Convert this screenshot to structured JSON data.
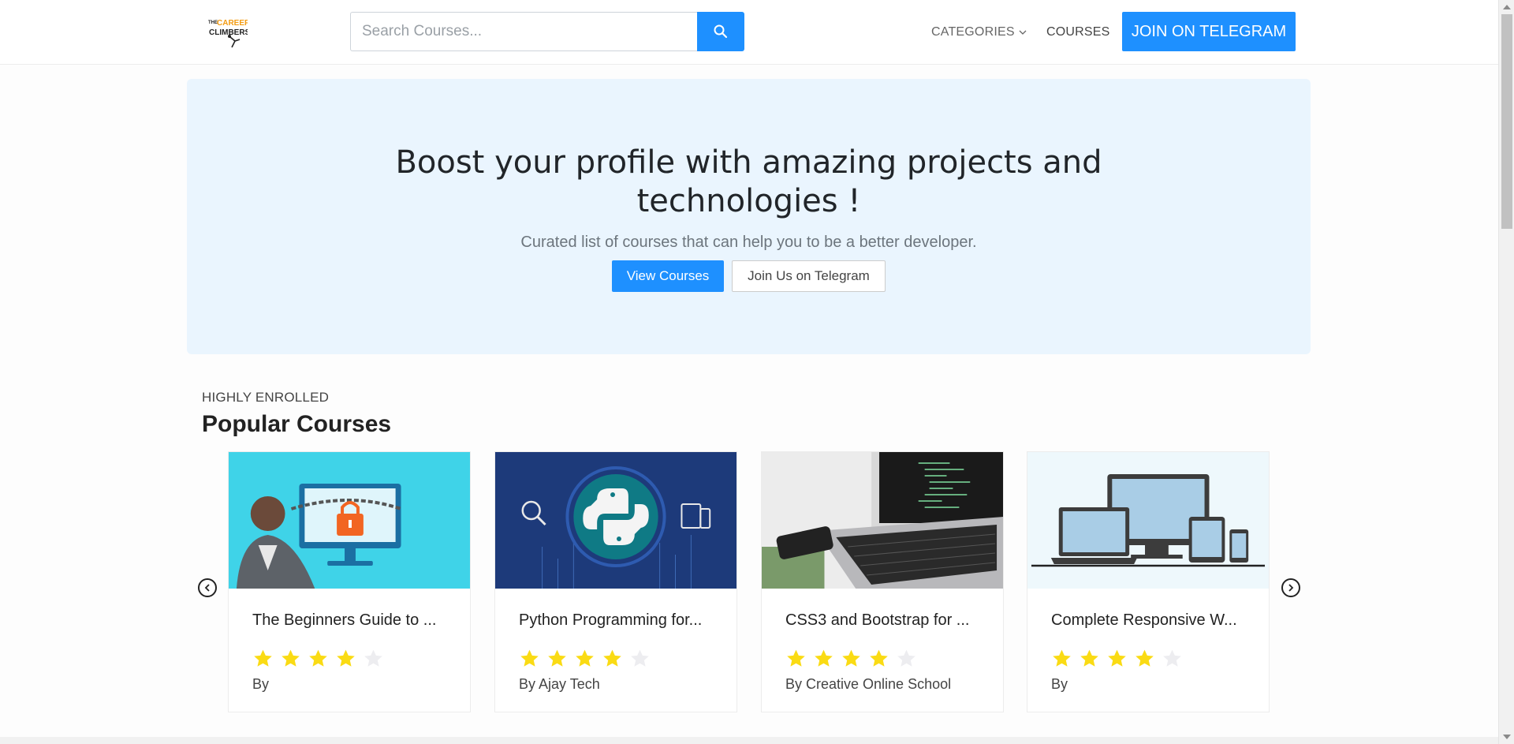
{
  "nav": {
    "logo_text": "THE CAREER CLIMBERS",
    "search_placeholder": "Search Courses...",
    "categories_label": "CATEGORIES",
    "courses_label": "COURSES",
    "telegram_button": "JOIN ON TELEGRAM",
    "accent_color": "#1e90ff"
  },
  "hero": {
    "title_line1": "Boost your profile with amazing projects and",
    "title_line2": "technologies !",
    "subtitle": "Curated list of courses that can help you to be a better developer.",
    "primary_button": "View Courses",
    "secondary_button": "Join Us on Telegram"
  },
  "section": {
    "eyebrow": "HIGHLY ENROLLED",
    "title": "Popular Courses"
  },
  "courses": [
    {
      "title": "The Beginners Guide to ...",
      "rating": 4,
      "max_rating": 5,
      "author": "By",
      "image_icon": "cyber-security-icon"
    },
    {
      "title": "Python Programming for...",
      "rating": 4,
      "max_rating": 5,
      "author": "By Ajay Tech",
      "image_icon": "python-logo-icon"
    },
    {
      "title": "CSS3 and Bootstrap for ...",
      "rating": 4,
      "max_rating": 5,
      "author": "By Creative Online School",
      "image_icon": "laptop-code-icon"
    },
    {
      "title": "Complete Responsive W...",
      "rating": 4,
      "max_rating": 5,
      "author": "By",
      "image_icon": "responsive-devices-icon"
    }
  ],
  "icons": {
    "search": "search-icon",
    "carousel_prev": "chevron-left-icon",
    "carousel_next": "chevron-right-icon",
    "star": "star-icon"
  }
}
